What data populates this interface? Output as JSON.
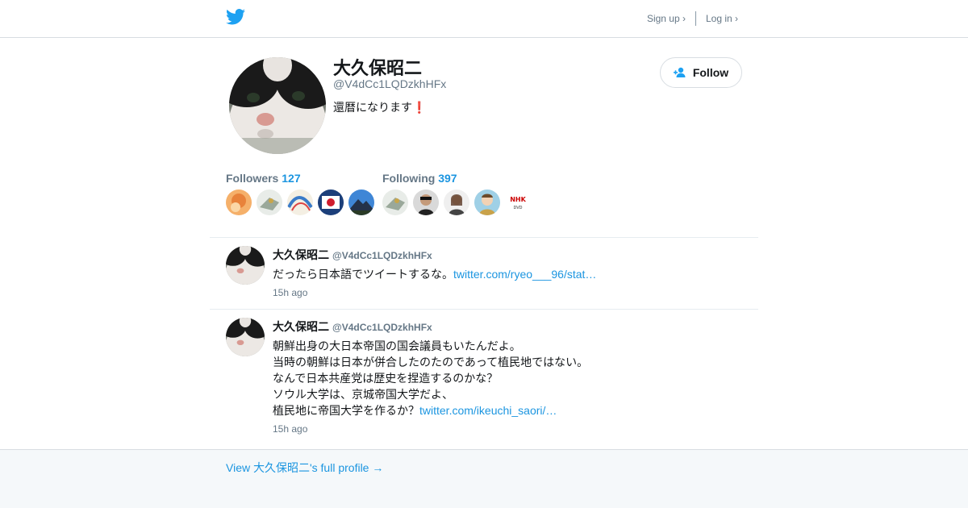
{
  "header": {
    "signup_label": "Sign up ›",
    "login_label": "Log in ›",
    "brand_color": "#1da1f2"
  },
  "profile": {
    "name": "大久保昭二",
    "handle": "@V4dCc1LQDzkhHFx",
    "bio": "還暦になります",
    "bio_emoji": "❗",
    "follow_label": "Follow",
    "followers_label": "Followers",
    "followers_count": "127",
    "following_label": "Following",
    "following_count": "397"
  },
  "followers_avatars": [
    "orange-portrait",
    "eagle-art",
    "wave-art",
    "japan-flag",
    "mountain-sky"
  ],
  "following_avatars": [
    "eagle-art",
    "man-portrait",
    "woman-portrait",
    "cartoon-boy",
    "nhk-logo"
  ],
  "tweets": [
    {
      "name": "大久保昭二",
      "handle": "@V4dCc1LQDzkhHFx",
      "lines": [
        "だったら日本語でツイートするな。"
      ],
      "link": "twitter.com/ryeo___96/stat…",
      "time": "15h ago"
    },
    {
      "name": "大久保昭二",
      "handle": "@V4dCc1LQDzkhHFx",
      "lines": [
        "朝鮮出身の大日本帝国の国会議員もいたんだよ。",
        "当時の朝鮮は日本が併合したのたのであって植民地ではない。",
        "なんで日本共産党は歴史を捏造するのかな？",
        "ソウル大学は、京城帝国大学だよ、",
        "植民地に帝国大学を作るか？"
      ],
      "link": "twitter.com/ikeuchi_saori/…",
      "time": "15h ago"
    }
  ],
  "footer": {
    "profile_link": "View 大久保昭二's full profile →"
  },
  "colors": {
    "link": "#1b95e0",
    "muted": "#657786",
    "footer_bg": "#f5f8fa"
  }
}
